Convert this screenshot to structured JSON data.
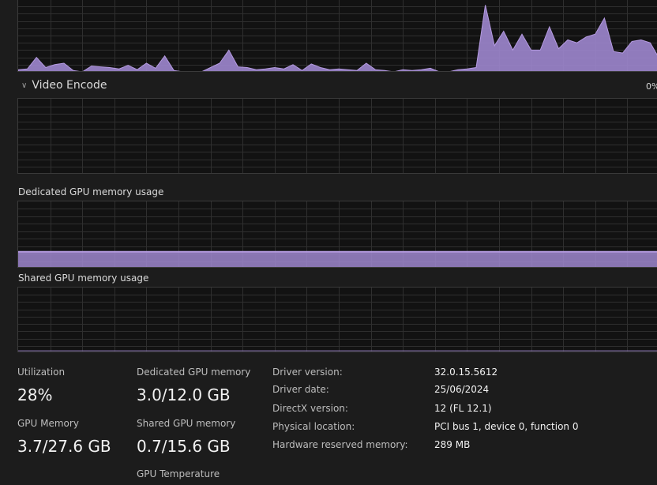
{
  "colors": {
    "graph_fill": "#9f87cf",
    "graph_line": "#b49ae0",
    "grid": "#2f2f2f",
    "background": "#1c1c1c"
  },
  "engine_3d": {
    "series": [
      3,
      4,
      20,
      6,
      10,
      12,
      2,
      0,
      8,
      7,
      6,
      4,
      9,
      3,
      12,
      5,
      22,
      2,
      0,
      0,
      0,
      6,
      12,
      30,
      7,
      6,
      3,
      4,
      6,
      4,
      10,
      2,
      11,
      6,
      3,
      4,
      3,
      2,
      12,
      3,
      2,
      0,
      3,
      2,
      3,
      5,
      0,
      0,
      3,
      4,
      6,
      92,
      36,
      56,
      30,
      52,
      30,
      30,
      62,
      32,
      44,
      40,
      48,
      52,
      74,
      28,
      26,
      42,
      44,
      40,
      18
    ]
  },
  "video_encode": {
    "label": "Video Encode",
    "percent": "0%"
  },
  "dedicated_memory_graph": {
    "label": "Dedicated GPU memory usage",
    "fill_fraction": 0.25
  },
  "shared_memory_graph": {
    "label": "Shared GPU memory usage",
    "fill_fraction": 0.045
  },
  "stats": {
    "utilization_label": "Utilization",
    "utilization_value": "28%",
    "gpu_memory_label": "GPU Memory",
    "gpu_memory_value": "3.7/27.6 GB",
    "dedicated_label": "Dedicated GPU memory",
    "dedicated_value": "3.0/12.0 GB",
    "shared_label": "Shared GPU memory",
    "shared_value": "0.7/15.6 GB",
    "temperature_label": "GPU Temperature"
  },
  "properties": [
    {
      "key": "Driver version:",
      "value": "32.0.15.5612"
    },
    {
      "key": "Driver date:",
      "value": "25/06/2024"
    },
    {
      "key": "DirectX version:",
      "value": "12 (FL 12.1)"
    },
    {
      "key": "Physical location:",
      "value": "PCI bus 1, device 0, function 0"
    },
    {
      "key": "Hardware reserved memory:",
      "value": "289 MB"
    }
  ]
}
